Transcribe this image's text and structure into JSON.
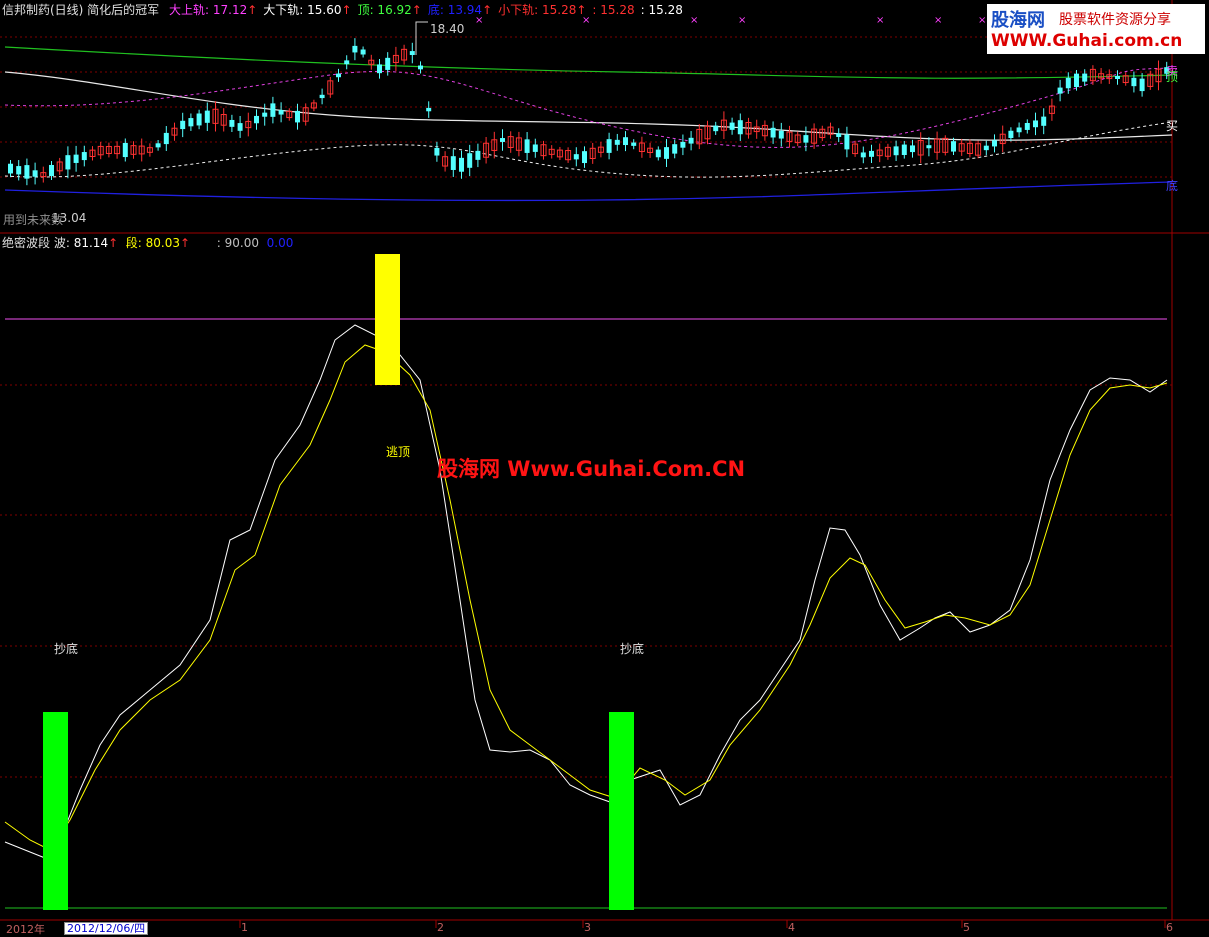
{
  "top_header": {
    "title": "信邦制药(日线) 简化后的冠军",
    "items": [
      {
        "label": "大上轨",
        "value": "17.12",
        "color": "#ff40ff"
      },
      {
        "label": "大下轨",
        "value": "15.60",
        "color": "#ffffff"
      },
      {
        "label": "顶",
        "value": "16.92",
        "color": "#40ff40"
      },
      {
        "label": "底",
        "value": "13.94",
        "color": "#2020ff"
      },
      {
        "label": "小下轨",
        "value": "15.28",
        "color": "#ff3030"
      },
      {
        "label": "",
        "value": "15.28",
        "color": "#ff3030"
      },
      {
        "label": "",
        "value": "15.28",
        "color": "#ffffff"
      }
    ],
    "up_arrow": "↑"
  },
  "price_pane": {
    "high_label": "18.40",
    "low_label": "13.04",
    "bottom_note": "用到未来数",
    "right_labels": {
      "sell": "卖",
      "top": "顶",
      "buy": "买",
      "bottom": "底"
    },
    "cross_marker": "×"
  },
  "indicator_header": {
    "name": "绝密波段",
    "wave_label": "波",
    "wave_value": "81.14",
    "seg_label": "段",
    "seg_value": "80.03",
    "level_value": "90.00",
    "zero_value": "0.00"
  },
  "signals": {
    "bottom1": "抄底",
    "bottom2": "抄底",
    "escape_top": "逃顶"
  },
  "watermarks": {
    "logo_cn": "股海网",
    "slogan": "股票软件资源分享",
    "url": "WWW.Guhai.com.cn",
    "center": "股海网 Www.Guhai.Com.CN"
  },
  "x_axis": {
    "labels": [
      "2012年",
      "1",
      "2",
      "3",
      "4",
      "5",
      "6"
    ],
    "selected_date": "2012/12/06/四"
  },
  "colors": {
    "wave": "#ffffff",
    "segment": "#ffff00",
    "bottom_bar": "#00ff00",
    "top_bar": "#ffff00",
    "level_line": "#c040c0",
    "grid": "#800000"
  }
}
